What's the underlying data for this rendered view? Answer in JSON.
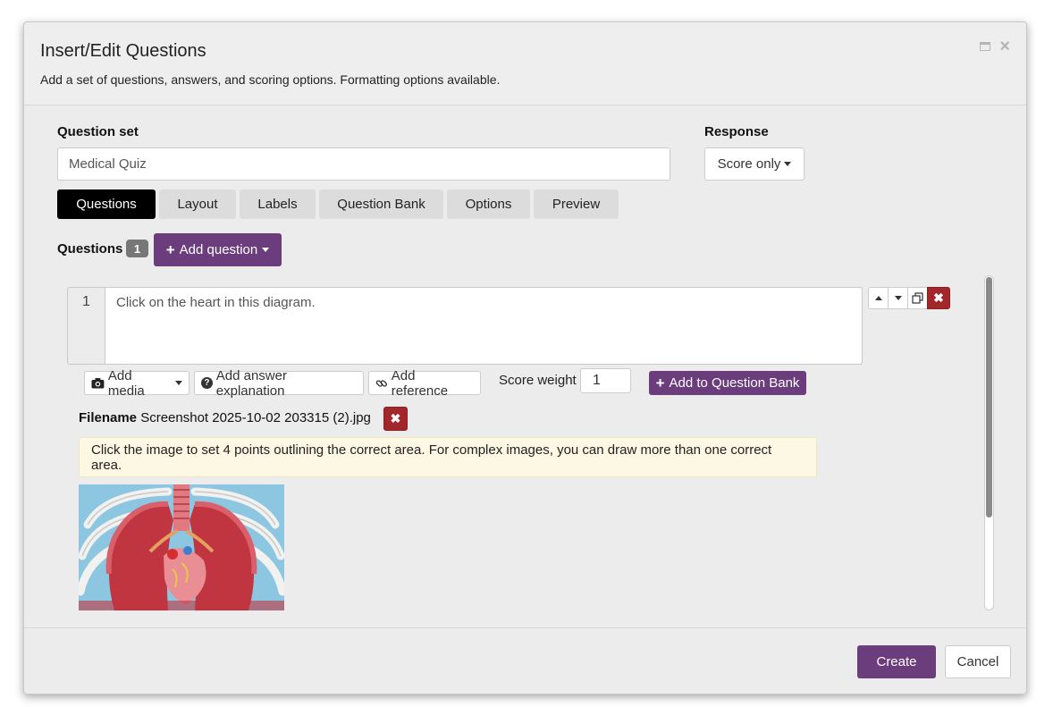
{
  "dialog": {
    "title": "Insert/Edit Questions",
    "subtitle": "Add a set of questions, answers, and scoring options. Formatting options available."
  },
  "question_set": {
    "label": "Question set",
    "value": "Medical Quiz"
  },
  "response": {
    "label": "Response",
    "selected": "Score only"
  },
  "tabs": [
    {
      "label": "Questions",
      "active": true
    },
    {
      "label": "Layout",
      "active": false
    },
    {
      "label": "Labels",
      "active": false
    },
    {
      "label": "Question Bank",
      "active": false
    },
    {
      "label": "Options",
      "active": false
    },
    {
      "label": "Preview",
      "active": false
    }
  ],
  "questions_section": {
    "label": "Questions",
    "count": "1",
    "add_question_label": "Add question"
  },
  "question": {
    "number": "1",
    "text": "Click on the heart in this diagram."
  },
  "toolbar": {
    "add_media": "Add media",
    "add_answer_explanation": "Add answer explanation",
    "add_reference": "Add reference",
    "score_weight_label": "Score weight",
    "score_weight_value": "1",
    "add_to_bank": "Add to Question Bank"
  },
  "media": {
    "filename_label": "Filename",
    "filename": "Screenshot 2025-10-02 203315 (2).jpg",
    "notice": "Click the image to set 4 points outlining the correct area. For complex images, you can draw more than one correct area."
  },
  "footer": {
    "create": "Create",
    "cancel": "Cancel"
  },
  "colors": {
    "brand_purple": "#6b3d7c",
    "danger_red": "#a3262a",
    "notice_bg": "#fcf8e3"
  },
  "icons": [
    "maximize-icon",
    "close-icon",
    "plus-icon",
    "camera-icon",
    "question-circle-icon",
    "link-icon",
    "arrow-up-icon",
    "arrow-down-icon",
    "copy-icon",
    "delete-icon"
  ]
}
